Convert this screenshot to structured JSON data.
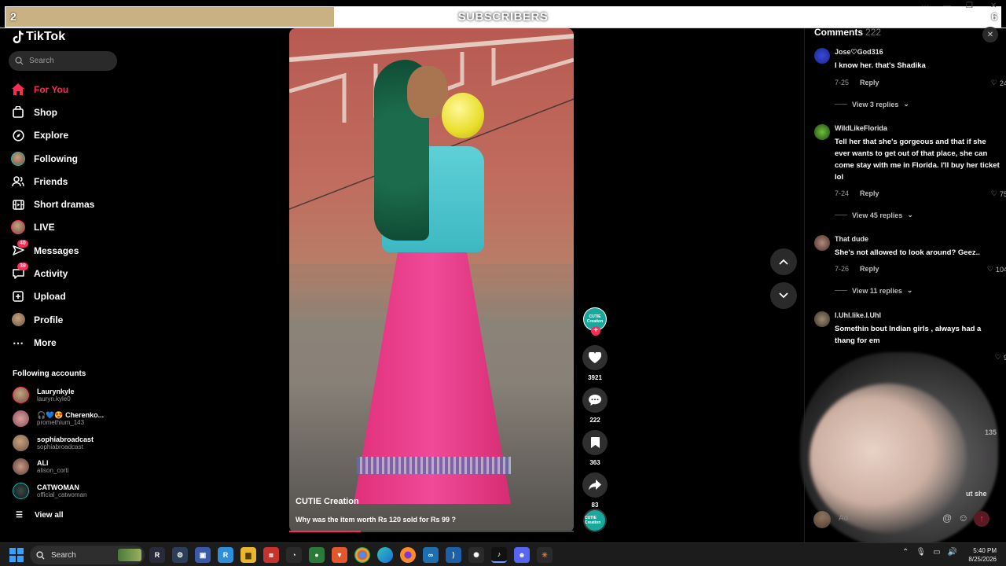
{
  "overlay": {
    "left_count": "2",
    "title": "SUBSCRIBERS",
    "right_count": "6",
    "progress_fraction": 0.33
  },
  "app": {
    "logo": "TikTok",
    "search_placeholder": "Search"
  },
  "nav": [
    {
      "label": "For You",
      "icon": "home-icon",
      "active": true
    },
    {
      "label": "Shop",
      "icon": "shop-icon"
    },
    {
      "label": "Explore",
      "icon": "compass-icon"
    },
    {
      "label": "Following",
      "icon": "following-avatar-icon"
    },
    {
      "label": "Friends",
      "icon": "friends-icon"
    },
    {
      "label": "Short dramas",
      "icon": "dramas-icon"
    },
    {
      "label": "LIVE",
      "icon": "live-icon"
    },
    {
      "label": "Messages",
      "icon": "messages-icon",
      "badge": "40"
    },
    {
      "label": "Activity",
      "icon": "activity-icon",
      "badge": "39"
    },
    {
      "label": "Upload",
      "icon": "upload-icon"
    },
    {
      "label": "Profile",
      "icon": "profile-avatar-icon"
    },
    {
      "label": "More",
      "icon": "more-icon"
    }
  ],
  "following_accounts": {
    "title": "Following accounts",
    "items": [
      {
        "name": "Laurynkyle",
        "handle": "lauryn.kyle0"
      },
      {
        "name": "🎧💙😍 Cherenko...",
        "handle": "promethium_143"
      },
      {
        "name": "sophiabroadcast",
        "handle": "sophiabroadcast"
      },
      {
        "name": "ALI",
        "handle": "alison_corti"
      },
      {
        "name": "CATWOMAN",
        "handle": "official_catwoman"
      }
    ],
    "view_all": "View all"
  },
  "video": {
    "author": "CUTIE Creation",
    "caption": "Why was the item worth Rs 120 sold for Rs 99 ?",
    "progress_fraction": 0.25,
    "avatar_text": "CUTIE Creation"
  },
  "actions": {
    "likes": "3921",
    "comments": "222",
    "saves": "363",
    "shares": "83"
  },
  "comments": {
    "title": "Comments",
    "count": "222",
    "items": [
      {
        "user": "Jose♡God316",
        "text": "I know her. that's Shadika",
        "date": "7-25",
        "reply": "Reply",
        "likes": "24",
        "replies": "View 3 replies"
      },
      {
        "user": "WildLikeFlorida",
        "text": "Tell her that she's gorgeous and that if she ever wants to get out of that place, she can come stay with me in Florida. I'll buy her ticket lol",
        "date": "7-24",
        "reply": "Reply",
        "likes": "75",
        "replies": "View 45 replies"
      },
      {
        "user": "That dude",
        "text": "She's not allowed to look around? Geez..",
        "date": "7-26",
        "reply": "Reply",
        "likes": "104",
        "replies": "View 11 replies"
      },
      {
        "user": "I.Uhl.like.I.Uhl",
        "text": "Somethin bout Indian girls , always had a thang for em",
        "likes": "9"
      }
    ],
    "ghost_count": "135",
    "ghost_text": "ut she",
    "input_placeholder": "Ad"
  },
  "taskbar": {
    "search": "Search",
    "time": "5:40 PM",
    "date": "8/25/2026"
  },
  "colors": {
    "accent": "#fe2c55",
    "overlay_fill": "#c9b183"
  }
}
